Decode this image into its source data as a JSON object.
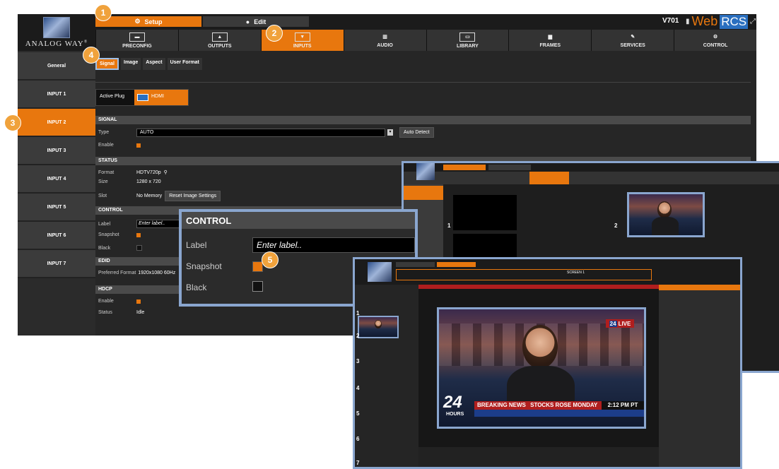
{
  "app": {
    "logo_text": "ANALOG WAY",
    "logo_reg": "®",
    "modes": {
      "setup": "Setup",
      "edit": "Edit"
    },
    "version": "V701",
    "brand_web": "Web",
    "brand_rcs": "RCS",
    "nav": [
      {
        "label": "PRECONFIG",
        "icon": "preconfig-icon"
      },
      {
        "label": "OUTPUTS",
        "icon": "outputs-icon"
      },
      {
        "label": "INPUTS",
        "icon": "inputs-icon"
      },
      {
        "label": "AUDIO",
        "icon": "audio-icon"
      },
      {
        "label": "LIBRARY",
        "icon": "library-icon"
      },
      {
        "label": "FRAMES",
        "icon": "frames-icon"
      },
      {
        "label": "SERVICES",
        "icon": "services-icon"
      },
      {
        "label": "CONTROL",
        "icon": "control-icon"
      }
    ],
    "sidebar": [
      "General",
      "INPUT 1",
      "INPUT 2",
      "INPUT 3",
      "INPUT 4",
      "INPUT 5",
      "INPUT 6",
      "INPUT 7"
    ],
    "subtabs": [
      "Signal",
      "Image",
      "Aspect",
      "User Format"
    ],
    "active_plug_label": "Active Plug",
    "active_plug_value": "HDMI",
    "signal": {
      "title": "SIGNAL",
      "type_label": "Type",
      "type_value": "AUTO",
      "enable_label": "Enable",
      "auto_detect": "Auto Detect"
    },
    "status": {
      "title": "STATUS",
      "format_label": "Format",
      "format_value": "HDTV720p",
      "size_label": "Size",
      "size_value": "1280 x 720",
      "slot_label": "Slot",
      "slot_value": "No Memory",
      "reset_button": "Reset Image Settings"
    },
    "control": {
      "title": "CONTROL",
      "label_label": "Label",
      "label_placeholder": "Enter label..",
      "snapshot_label": "Snapshot",
      "black_label": "Black"
    },
    "edid": {
      "title": "EDID",
      "preferred_label": "Preferred Format",
      "preferred_value": "1920x1080 60Hz"
    },
    "hdcp": {
      "title": "HDCP",
      "enable_label": "Enable",
      "status_label": "Status",
      "status_value": "Idle"
    }
  },
  "zoom": {
    "title": "CONTROL",
    "label": "Label",
    "placeholder": "Enter label..",
    "snapshot": "Snapshot",
    "black": "Black"
  },
  "badges": [
    "1",
    "2",
    "3",
    "4",
    "5"
  ],
  "live_preview": {
    "channel": "24",
    "live": "LIVE",
    "hours": "HOURS",
    "breaking": "BREAKING NEWS",
    "headline": "STOCKS ROSE MONDAY",
    "time": "2:12 PM PT",
    "screen_label": "SCREEN 1",
    "tile_numbers": [
      "1",
      "2",
      "3",
      "4",
      "5",
      "6",
      "7"
    ]
  },
  "mid_shot": {
    "tile_numbers": [
      "1",
      "2"
    ]
  },
  "colors": {
    "accent": "#e8770e",
    "panel": "#262626",
    "highlight": "#8aa6cf",
    "brand_blue": "#2a6fbf"
  }
}
